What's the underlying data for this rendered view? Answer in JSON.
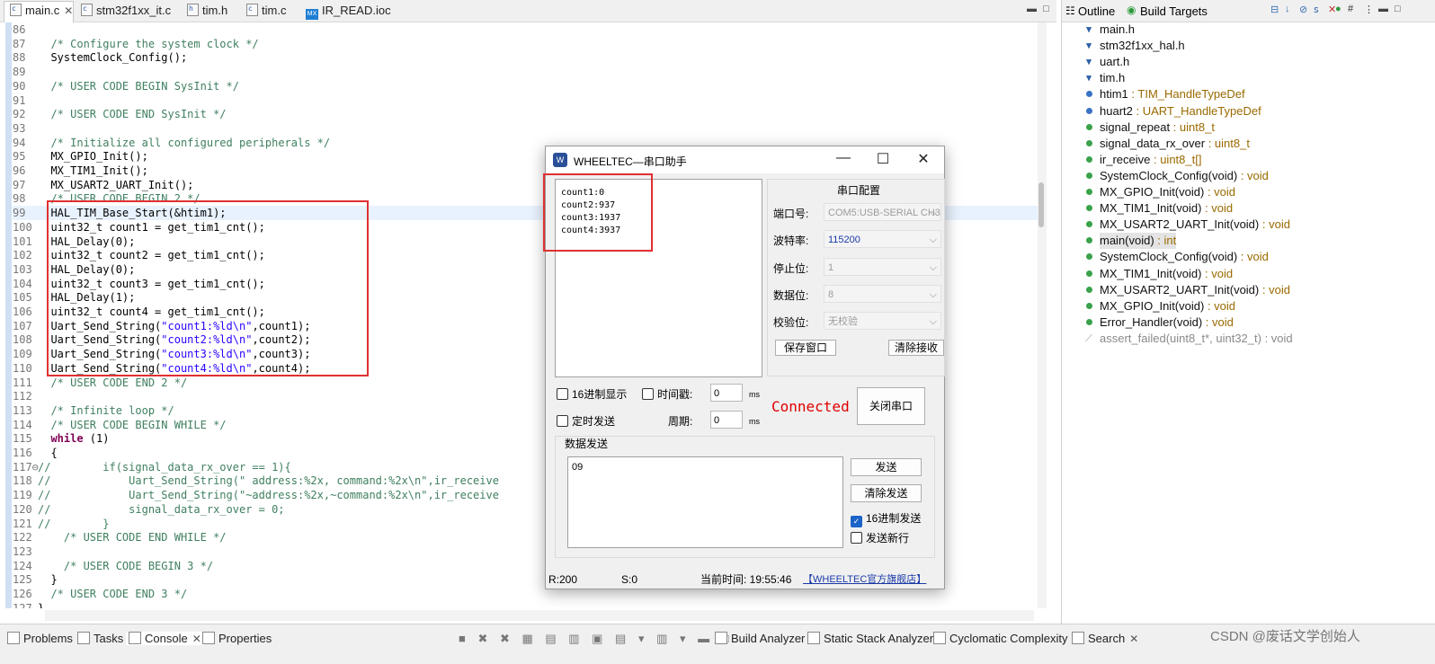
{
  "editor_tabs": [
    {
      "label": "main.c",
      "active": true,
      "icon": "c-file-icon"
    },
    {
      "label": "stm32f1xx_it.c",
      "icon": "c-file-icon"
    },
    {
      "label": "tim.h",
      "icon": "h-file-icon"
    },
    {
      "label": "tim.c",
      "icon": "c-file-icon"
    },
    {
      "label": "IR_READ.ioc",
      "icon": "mx-file-icon"
    }
  ],
  "code_lines": [
    {
      "n": "86",
      "parts": []
    },
    {
      "n": "87",
      "parts": [
        {
          "c": "tx",
          "t": "  "
        },
        {
          "c": "cm",
          "t": "/* Configure the system clock */"
        }
      ]
    },
    {
      "n": "88",
      "parts": [
        {
          "c": "tx",
          "t": "  SystemClock_Config();"
        }
      ]
    },
    {
      "n": "89",
      "parts": []
    },
    {
      "n": "90",
      "parts": [
        {
          "c": "tx",
          "t": "  "
        },
        {
          "c": "cm",
          "t": "/* USER CODE BEGIN SysInit */"
        }
      ]
    },
    {
      "n": "91",
      "parts": []
    },
    {
      "n": "92",
      "parts": [
        {
          "c": "tx",
          "t": "  "
        },
        {
          "c": "cm",
          "t": "/* USER CODE END SysInit */"
        }
      ]
    },
    {
      "n": "93",
      "parts": []
    },
    {
      "n": "94",
      "parts": [
        {
          "c": "tx",
          "t": "  "
        },
        {
          "c": "cm",
          "t": "/* Initialize all configured peripherals */"
        }
      ]
    },
    {
      "n": "95",
      "parts": [
        {
          "c": "tx",
          "t": "  MX_GPIO_Init();"
        }
      ]
    },
    {
      "n": "96",
      "parts": [
        {
          "c": "tx",
          "t": "  MX_TIM1_Init();"
        }
      ]
    },
    {
      "n": "97",
      "parts": [
        {
          "c": "tx",
          "t": "  MX_USART2_UART_Init();"
        }
      ]
    },
    {
      "n": "98",
      "parts": [
        {
          "c": "tx",
          "t": "  "
        },
        {
          "c": "cm",
          "t": "/* USER CODE BEGIN 2 */"
        }
      ]
    },
    {
      "n": "99",
      "hl": true,
      "parts": [
        {
          "c": "tx",
          "t": "  HAL_TIM_Base_Start(&htim1);"
        }
      ]
    },
    {
      "n": "100",
      "parts": [
        {
          "c": "tx",
          "t": "  uint32_t count1 = get_tim1_cnt();"
        }
      ]
    },
    {
      "n": "101",
      "parts": [
        {
          "c": "tx",
          "t": "  HAL_Delay(0);"
        }
      ]
    },
    {
      "n": "102",
      "parts": [
        {
          "c": "tx",
          "t": "  uint32_t count2 = get_tim1_cnt();"
        }
      ]
    },
    {
      "n": "103",
      "parts": [
        {
          "c": "tx",
          "t": "  HAL_Delay(0);"
        }
      ]
    },
    {
      "n": "104",
      "parts": [
        {
          "c": "tx",
          "t": "  uint32_t count3 = get_tim1_cnt();"
        }
      ]
    },
    {
      "n": "105",
      "parts": [
        {
          "c": "tx",
          "t": "  HAL_Delay(1);"
        }
      ]
    },
    {
      "n": "106",
      "parts": [
        {
          "c": "tx",
          "t": "  uint32_t count4 = get_tim1_cnt();"
        }
      ]
    },
    {
      "n": "107",
      "parts": [
        {
          "c": "tx",
          "t": "  Uart_Send_String("
        },
        {
          "c": "st",
          "t": "\"count1:%ld\\n\""
        },
        {
          "c": "tx",
          "t": ",count1);"
        }
      ]
    },
    {
      "n": "108",
      "parts": [
        {
          "c": "tx",
          "t": "  Uart_Send_String("
        },
        {
          "c": "st",
          "t": "\"count2:%ld\\n\""
        },
        {
          "c": "tx",
          "t": ",count2);"
        }
      ]
    },
    {
      "n": "109",
      "parts": [
        {
          "c": "tx",
          "t": "  Uart_Send_String("
        },
        {
          "c": "st",
          "t": "\"count3:%ld\\n\""
        },
        {
          "c": "tx",
          "t": ",count3);"
        }
      ]
    },
    {
      "n": "110",
      "parts": [
        {
          "c": "tx",
          "t": "  Uart_Send_String("
        },
        {
          "c": "st",
          "t": "\"count4:%ld\\n\""
        },
        {
          "c": "tx",
          "t": ",count4);"
        }
      ]
    },
    {
      "n": "111",
      "parts": [
        {
          "c": "tx",
          "t": "  "
        },
        {
          "c": "cm",
          "t": "/* USER CODE END 2 */"
        }
      ]
    },
    {
      "n": "112",
      "parts": []
    },
    {
      "n": "113",
      "parts": [
        {
          "c": "tx",
          "t": "  "
        },
        {
          "c": "cm",
          "t": "/* Infinite loop */"
        }
      ]
    },
    {
      "n": "114",
      "parts": [
        {
          "c": "tx",
          "t": "  "
        },
        {
          "c": "cm",
          "t": "/* USER CODE BEGIN WHILE */"
        }
      ]
    },
    {
      "n": "115",
      "parts": [
        {
          "c": "tx",
          "t": "  "
        },
        {
          "c": "kw",
          "t": "while"
        },
        {
          "c": "tx",
          "t": " (1)"
        }
      ]
    },
    {
      "n": "116",
      "parts": [
        {
          "c": "tx",
          "t": "  {"
        }
      ]
    },
    {
      "n": "117⊖",
      "parts": [
        {
          "c": "cm",
          "t": "//        if(signal_data_rx_over == 1){"
        }
      ]
    },
    {
      "n": "118",
      "parts": [
        {
          "c": "cm",
          "t": "//            Uart_Send_String(\" address:%2x, command:%2x\\n\",ir_receive"
        }
      ]
    },
    {
      "n": "119",
      "parts": [
        {
          "c": "cm",
          "t": "//            Uart_Send_String(\"~address:%2x,~command:%2x\\n\",ir_receive"
        }
      ]
    },
    {
      "n": "120",
      "parts": [
        {
          "c": "cm",
          "t": "//            signal_data_rx_over = 0;"
        }
      ]
    },
    {
      "n": "121",
      "parts": [
        {
          "c": "cm",
          "t": "//        }"
        }
      ]
    },
    {
      "n": "122",
      "parts": [
        {
          "c": "tx",
          "t": "    "
        },
        {
          "c": "cm",
          "t": "/* USER CODE END WHILE */"
        }
      ]
    },
    {
      "n": "123",
      "parts": []
    },
    {
      "n": "124",
      "parts": [
        {
          "c": "tx",
          "t": "    "
        },
        {
          "c": "cm",
          "t": "/* USER CODE BEGIN 3 */"
        }
      ]
    },
    {
      "n": "125",
      "parts": [
        {
          "c": "tx",
          "t": "  }"
        }
      ]
    },
    {
      "n": "126",
      "parts": [
        {
          "c": "tx",
          "t": "  "
        },
        {
          "c": "cm",
          "t": "/* USER CODE END 3 */"
        }
      ]
    },
    {
      "n": "127",
      "parts": [
        {
          "c": "tx",
          "t": "}"
        }
      ]
    }
  ],
  "outline": {
    "tabs": [
      {
        "label": "Outline",
        "icon": "outline-icon"
      },
      {
        "label": "Build Targets",
        "icon": "build-targets-icon"
      }
    ],
    "items": [
      {
        "name": "main.h",
        "type": "",
        "icon": "include-icon",
        "color": "#2b5fa8"
      },
      {
        "name": "stm32f1xx_hal.h",
        "type": "",
        "icon": "include-icon",
        "color": "#2b5fa8"
      },
      {
        "name": "uart.h",
        "type": "",
        "icon": "include-icon",
        "color": "#2b5fa8"
      },
      {
        "name": "tim.h",
        "type": "",
        "icon": "include-icon",
        "color": "#2b5fa8"
      },
      {
        "name": "htim1",
        "type": " : TIM_HandleTypeDef",
        "icon": "variable-icon",
        "color": "#3a72c4"
      },
      {
        "name": "huart2",
        "type": " : UART_HandleTypeDef",
        "icon": "variable-icon",
        "color": "#3a72c4"
      },
      {
        "name": "signal_repeat",
        "type": " : uint8_t",
        "icon": "variable-icon",
        "color": "#3aa24a"
      },
      {
        "name": "signal_data_rx_over",
        "type": " : uint8_t",
        "icon": "variable-icon",
        "color": "#3aa24a"
      },
      {
        "name": "ir_receive",
        "type": " : uint8_t[]",
        "icon": "variable-icon",
        "color": "#3aa24a"
      },
      {
        "name": "SystemClock_Config(void)",
        "type": " : void",
        "icon": "function-decl-icon",
        "color": "#3aa24a"
      },
      {
        "name": "MX_GPIO_Init(void)",
        "type": " : void",
        "icon": "static-function-decl-icon",
        "color": "#3aa24a"
      },
      {
        "name": "MX_TIM1_Init(void)",
        "type": " : void",
        "icon": "static-function-decl-icon",
        "color": "#3aa24a"
      },
      {
        "name": "MX_USART2_UART_Init(void)",
        "type": " : void",
        "icon": "static-function-decl-icon",
        "color": "#3aa24a"
      },
      {
        "name": "main(void)",
        "type": " : int",
        "icon": "function-icon",
        "color": "#3aa24a",
        "selected": true
      },
      {
        "name": "SystemClock_Config(void)",
        "type": " : void",
        "icon": "function-icon",
        "color": "#3aa24a"
      },
      {
        "name": "MX_TIM1_Init(void)",
        "type": " : void",
        "icon": "static-function-icon",
        "color": "#3aa24a"
      },
      {
        "name": "MX_USART2_UART_Init(void)",
        "type": " : void",
        "icon": "static-function-icon",
        "color": "#3aa24a"
      },
      {
        "name": "MX_GPIO_Init(void)",
        "type": " : void",
        "icon": "static-function-icon",
        "color": "#3aa24a"
      },
      {
        "name": "Error_Handler(void)",
        "type": " : void",
        "icon": "function-icon",
        "color": "#3aa24a"
      },
      {
        "name": "assert_failed(uint8_t*, uint32_t)",
        "type": " : void",
        "icon": "disabled-function-icon",
        "color": "#9a9a9a",
        "disabled": true
      }
    ]
  },
  "bottom_tabs": {
    "left": [
      {
        "label": "Problems",
        "icon": "problems-icon"
      },
      {
        "label": "Tasks",
        "icon": "tasks-icon"
      },
      {
        "label": "Console",
        "icon": "console-icon",
        "active": true
      },
      {
        "label": "Properties",
        "icon": "properties-icon"
      }
    ],
    "right": [
      {
        "label": "Build Analyzer",
        "icon": "build-analyzer-icon"
      },
      {
        "label": "Static Stack Analyzer",
        "icon": "stack-analyzer-icon"
      },
      {
        "label": "Cyclomatic Complexity",
        "icon": "complexity-icon"
      },
      {
        "label": "Search",
        "icon": "search-icon",
        "active": true
      }
    ],
    "watermark": "CSDN @废话文学创始人"
  },
  "serial_dialog": {
    "title": "WHEELTEC—串口助手",
    "received_lines": [
      "count1:0",
      "count2:937",
      "count3:1937",
      "count4:3937"
    ],
    "config": {
      "group_title": "串口配置",
      "port_label": "端口号:",
      "port_value": "COM5:USB-SERIAL CH340",
      "baud_label": "波特率:",
      "baud_value": "115200",
      "stop_label": "停止位:",
      "stop_value": "1",
      "data_label": "数据位:",
      "data_value": "8",
      "parity_label": "校验位:",
      "parity_value": "无校验",
      "save_window": "保存窗口",
      "clear_receive": "清除接收"
    },
    "hex_display": "16进制显示",
    "timestamp": "时间戳:",
    "timestamp_value": "0",
    "timestamp_unit": "ms",
    "timed_send": "定时发送",
    "period": "周期:",
    "period_value": "0",
    "period_unit": "ms",
    "status": "Connected",
    "close_port": "关闭串口",
    "send_group_title": "数据发送",
    "send_text": "09",
    "send_button": "发送",
    "clear_send": "清除发送",
    "hex_send": "16进制发送",
    "hex_send_checked": true,
    "send_newline": "发送新行",
    "status_r": "R:200",
    "status_s": "S:0",
    "status_time": "当前时间: 19:55:46",
    "store_link": "【WHEELTEC官方旗舰店】"
  }
}
